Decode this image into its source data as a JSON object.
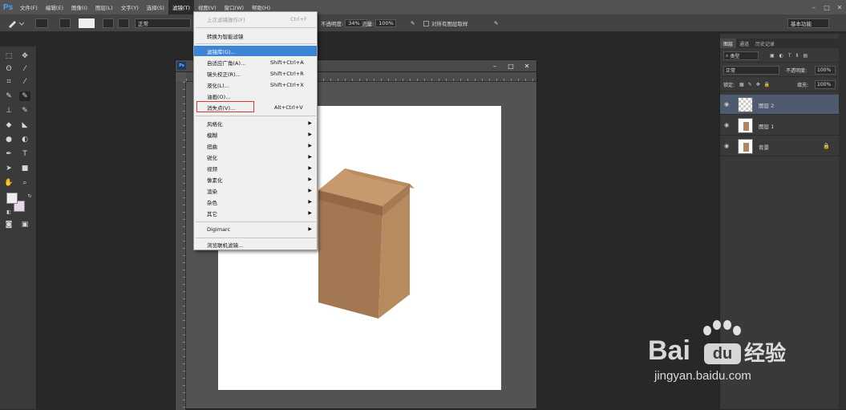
{
  "app": {
    "logo": "Ps"
  },
  "menubar": {
    "items": [
      "文件(F)",
      "编辑(E)",
      "图像(I)",
      "图层(L)",
      "文字(Y)",
      "选择(S)",
      "滤镜(T)",
      "视图(V)",
      "窗口(W)",
      "帮助(H)"
    ],
    "active_index": 6
  },
  "options_bar": {
    "mode": "正常",
    "opacity_label": "不透明度:",
    "opacity": "34%",
    "flow_label": "流量:",
    "flow": "100%",
    "sample_all": "对所有图层取样",
    "workspace": "基本功能"
  },
  "filter_menu": {
    "items": [
      {
        "label": "上次滤镜操作(F)",
        "shortcut": "Ctrl+F",
        "disabled": true
      },
      {
        "label": "转换为智能滤镜",
        "shortcut": ""
      },
      {
        "label": "滤镜库(G)...",
        "shortcut": "",
        "highlighted": true
      },
      {
        "label": "自适应广角(A)...",
        "shortcut": "Shift+Ctrl+A"
      },
      {
        "label": "镜头校正(R)...",
        "shortcut": "Shift+Ctrl+R"
      },
      {
        "label": "液化(L)...",
        "shortcut": "Shift+Ctrl+X"
      },
      {
        "label": "油画(O)...",
        "shortcut": ""
      },
      {
        "label": "消失点(V)...",
        "shortcut": "Alt+Ctrl+V",
        "boxed": true
      },
      {
        "label": "风格化",
        "submenu": true
      },
      {
        "label": "模糊",
        "submenu": true
      },
      {
        "label": "扭曲",
        "submenu": true
      },
      {
        "label": "锐化",
        "submenu": true
      },
      {
        "label": "视频",
        "submenu": true
      },
      {
        "label": "像素化",
        "submenu": true
      },
      {
        "label": "渲染",
        "submenu": true
      },
      {
        "label": "杂色",
        "submenu": true
      },
      {
        "label": "其它",
        "submenu": true
      },
      {
        "label": "Digimarc",
        "submenu": true
      },
      {
        "label": "浏览联机滤镜...",
        "shortcut": ""
      }
    ]
  },
  "layers_panel": {
    "tabs": [
      "图层",
      "通道",
      "历史记录"
    ],
    "kind": "类型",
    "blend_mode": "正常",
    "opacity_label": "不透明度:",
    "opacity": "100%",
    "lock_label": "锁定:",
    "fill_label": "填充:",
    "fill": "100%",
    "layers": [
      {
        "name": "图层 2",
        "selected": true,
        "thumb": "transparent"
      },
      {
        "name": "图层 1",
        "selected": false,
        "thumb": "box"
      },
      {
        "name": "背景",
        "selected": false,
        "thumb": "box",
        "locked": true
      }
    ]
  },
  "watermark": {
    "brand": "Bai",
    "du": "du",
    "suffix": "经验",
    "url": "jingyan.baidu.com"
  },
  "colors": {
    "highlight": "#3b84d6",
    "red_box": "#d9353a",
    "canvas": "#ffffff",
    "kraft": "#b3855c"
  }
}
